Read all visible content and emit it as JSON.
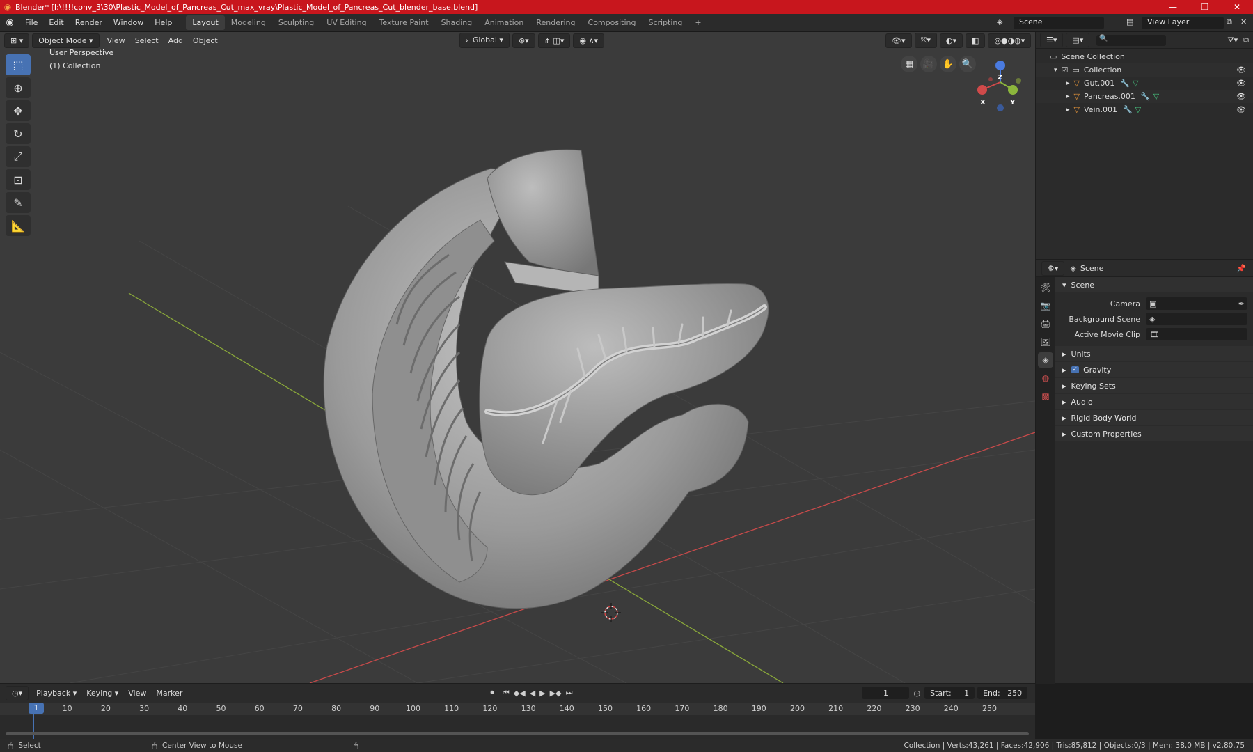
{
  "window": {
    "title": "Blender* [I:\\!!!!conv_3\\30\\Plastic_Model_of_Pancreas_Cut_max_vray\\Plastic_Model_of_Pancreas_Cut_blender_base.blend]",
    "minimize": "—",
    "maximize": "❐",
    "close": "✕"
  },
  "menubar": {
    "items": [
      "File",
      "Edit",
      "Render",
      "Window",
      "Help"
    ],
    "workspaces": [
      "Layout",
      "Modeling",
      "Sculpting",
      "UV Editing",
      "Texture Paint",
      "Shading",
      "Animation",
      "Rendering",
      "Compositing",
      "Scripting"
    ],
    "active_workspace": "Layout",
    "add_workspace": "+",
    "scene": "Scene",
    "view_layer": "View Layer"
  },
  "viewport": {
    "mode": "Object Mode",
    "menus": [
      "View",
      "Select",
      "Add",
      "Object"
    ],
    "orientation": "Global",
    "perspective_label": "User Perspective",
    "collection_label": "(1) Collection",
    "gizmo_axes": {
      "x": "X",
      "y": "Y",
      "z": "Z"
    },
    "colors": {
      "background": "#3b3b3b",
      "model": "#9c9c9c",
      "x_axis": "#c84a4a",
      "y_axis": "#8aa83a",
      "accent": "#4772b3"
    }
  },
  "tools": [
    "select-box-icon",
    "cursor-icon",
    "move-icon",
    "rotate-icon",
    "scale-icon",
    "transform-icon",
    "annotate-icon",
    "measure-icon"
  ],
  "outliner": {
    "scene_collection": "Scene Collection",
    "collection": "Collection",
    "objects": [
      "Gut.001",
      "Pancreas.001",
      "Vein.001"
    ]
  },
  "properties": {
    "header": "Scene",
    "section": "Scene",
    "fields": [
      {
        "label": "Camera",
        "value": ""
      },
      {
        "label": "Background Scene",
        "value": ""
      },
      {
        "label": "Active Movie Clip",
        "value": ""
      }
    ],
    "panels": [
      "Units",
      "Gravity",
      "Keying Sets",
      "Audio",
      "Rigid Body World",
      "Custom Properties"
    ]
  },
  "timeline": {
    "menus": [
      "Playback",
      "Keying",
      "View",
      "Marker"
    ],
    "current_frame": "1",
    "start_label": "Start:",
    "start": "1",
    "end_label": "End:",
    "end": "250",
    "ticks": [
      "10",
      "20",
      "30",
      "40",
      "50",
      "60",
      "70",
      "80",
      "90",
      "100",
      "110",
      "120",
      "130",
      "140",
      "150",
      "160",
      "170",
      "180",
      "190",
      "200",
      "210",
      "220",
      "230",
      "240",
      "250"
    ]
  },
  "statusbar": {
    "left": "Select",
    "middle": "Center View to Mouse",
    "right": "Collection | Verts:43,261 | Faces:42,906 | Tris:85,812 | Objects:0/3 | Mem: 38.0 MB | v2.80.75"
  }
}
